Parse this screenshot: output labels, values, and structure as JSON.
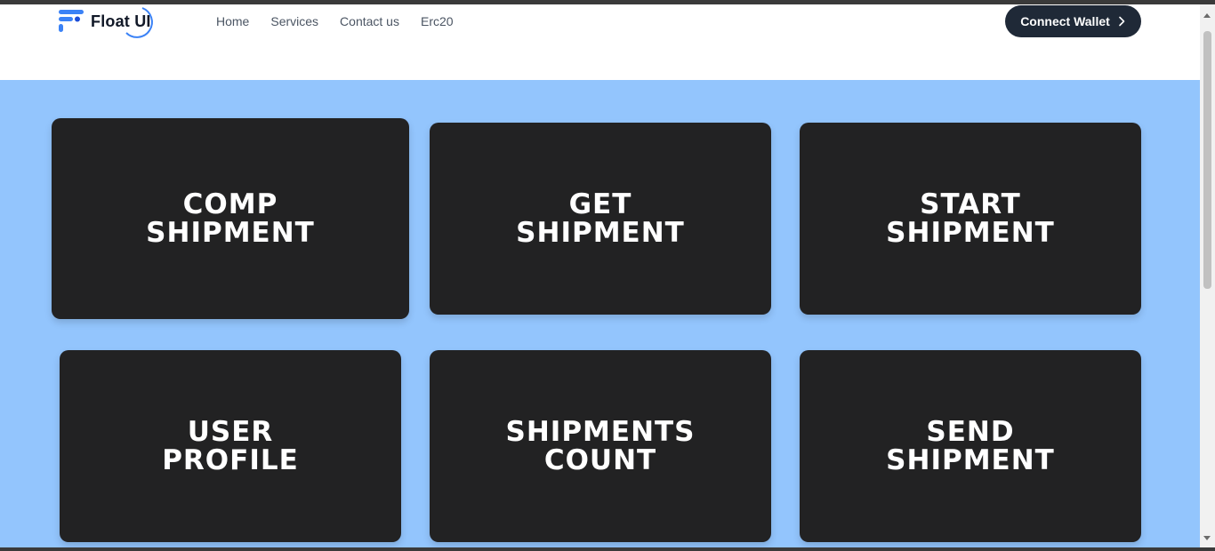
{
  "brand": {
    "name": "Float UI",
    "accent": "#3b82f6"
  },
  "nav": {
    "items": [
      {
        "label": "Home"
      },
      {
        "label": "Services"
      },
      {
        "label": "Contact us"
      },
      {
        "label": "Erc20"
      }
    ]
  },
  "header": {
    "connect_label": "Connect Wallet",
    "connect_icon": "chevron-right-icon"
  },
  "colors": {
    "page_bg": "#93c5fd",
    "card_bg": "#222223",
    "button_bg": "#1f2937"
  },
  "cards": [
    {
      "line1": "COMP",
      "line2": "SHIPMENT"
    },
    {
      "line1": "GET",
      "line2": "SHIPMENT"
    },
    {
      "line1": "START",
      "line2": "SHIPMENT"
    },
    {
      "line1": "USER",
      "line2": "PROFILE"
    },
    {
      "line1": "SHIPMENTS",
      "line2": "COUNT"
    },
    {
      "line1": "SEND",
      "line2": "SHIPMENT"
    }
  ]
}
